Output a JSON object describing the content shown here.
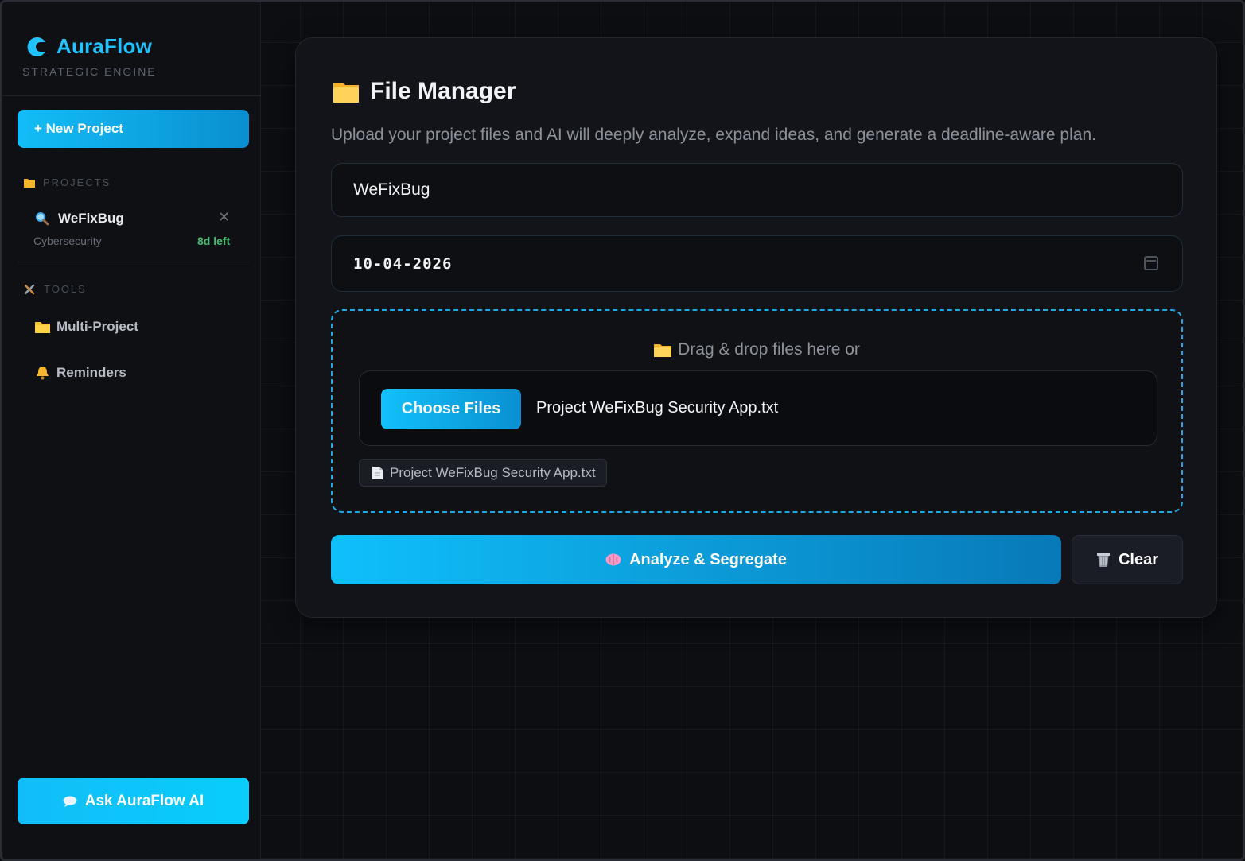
{
  "sidebar": {
    "brand": {
      "name": "AuraFlow",
      "subtitle": "STRATEGIC ENGINE"
    },
    "new_project_label": "+ New Project",
    "projects_heading": "PROJECTS",
    "projects": [
      {
        "name": "WeFixBug",
        "category": "Cybersecurity",
        "days_left": "8d left",
        "icon": "magnifier-icon"
      }
    ],
    "tools_heading": "TOOLS",
    "tools": [
      {
        "label": "Multi-Project",
        "icon": "folder-icon"
      },
      {
        "label": "Reminders",
        "icon": "bell-icon"
      }
    ],
    "ask_label": "Ask AuraFlow AI"
  },
  "file_manager": {
    "title": "File Manager",
    "subtitle": "Upload your project files and AI will deeply analyze, expand ideas, and generate a deadline-aware plan.",
    "project_name_value": "WeFixBug",
    "deadline_value": "10-04-2026",
    "drop_text": "Drag & drop files here or",
    "choose_files_label": "Choose Files",
    "chosen_file_name": "Project WeFixBug Security App.txt",
    "uploaded_files": [
      "Project WeFixBug Security App.txt"
    ],
    "analyze_label": "Analyze & Segregate",
    "clear_label": "Clear"
  },
  "colors": {
    "accent": "#12bdf7",
    "accent_dark": "#0879b8",
    "background": "#0c0e12",
    "card": "#121419",
    "success": "#3fbf72"
  }
}
